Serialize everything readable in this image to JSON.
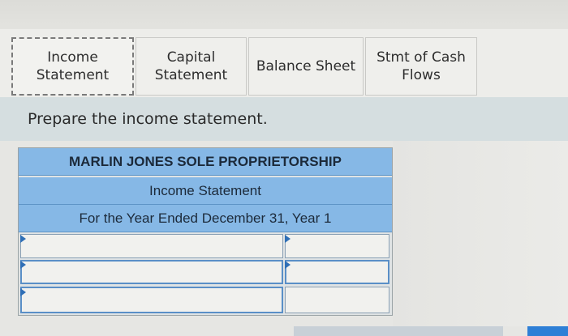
{
  "tabs": [
    {
      "label": "Income\nStatement",
      "active": true
    },
    {
      "label": "Capital\nStatement",
      "active": false
    },
    {
      "label": "Balance Sheet",
      "active": false
    },
    {
      "label": "Stmt of Cash\nFlows",
      "active": false
    }
  ],
  "instruction": "Prepare the income statement.",
  "statement": {
    "company": "MARLIN JONES SOLE PROPRIETORSHIP",
    "title": "Income Statement",
    "period": "For the Year Ended December 31, Year 1"
  },
  "rows": [
    {
      "label": "",
      "amount": ""
    },
    {
      "label": "",
      "amount": ""
    },
    {
      "label": "",
      "amount": ""
    }
  ],
  "colors": {
    "header_blue": "#86b8e6",
    "accent_blue": "#2e7fd6"
  }
}
